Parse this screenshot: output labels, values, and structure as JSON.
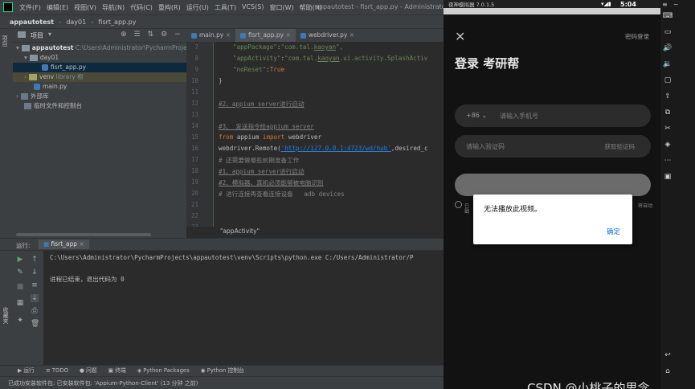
{
  "ide": {
    "window_title": "appautotest - fisrt_app.py - Administrator",
    "menus": [
      "文件(F)",
      "编辑(E)",
      "视图(V)",
      "导航(N)",
      "代码(C)",
      "重构(R)",
      "运行(U)",
      "工具(T)",
      "VCS(S)",
      "窗口(W)",
      "帮助(H)"
    ],
    "breadcrumb": [
      "appautotest",
      "day01",
      "fisrt_app.py"
    ],
    "project_panel_label": "项目",
    "left_strip_label": "项目",
    "tree": [
      {
        "label": "appautotest",
        "extra": "C:\\Users\\Administrator\\PycharmProjec",
        "type": "folder"
      },
      {
        "label": "day01",
        "extra": "",
        "type": "folder"
      },
      {
        "label": "fisrt_app.py",
        "extra": "",
        "type": "py"
      },
      {
        "label": "venv",
        "extra": "library 根",
        "type": "folder"
      },
      {
        "label": "main.py",
        "extra": "",
        "type": "py"
      },
      {
        "label": "外部库",
        "extra": "",
        "type": "lib"
      },
      {
        "label": "临时文件和控制台",
        "extra": "",
        "type": "scratch"
      }
    ],
    "editor_tabs": [
      "main.py",
      "fisrt_app.py",
      "webdriver.py"
    ],
    "line_numbers": [
      "7",
      "8",
      "9",
      "10",
      "11",
      "12",
      "13",
      "14",
      "15",
      "16",
      "17",
      "18",
      "19",
      "20",
      "21",
      "22",
      "23"
    ],
    "code": {
      "l7a": "\"appPackage\"",
      "l7b": ":",
      "l7c": "\"com.tal.",
      "l7d": "kaoyan",
      "l7e": "\",",
      "l8a": "\"appActivity\"",
      "l8b": ":",
      "l8c": "\"com.tal.",
      "l8d": "kaoyan",
      "l8e": ".ui.activity.SplashActiv",
      "l9a": "\"noReset\"",
      "l9b": ":",
      "l9c": "True",
      "l10": "}",
      "l12": "#2、appium server进行启动",
      "l14": "#3、 发送指令给appium server",
      "l15a": "from",
      "l15b": " appium ",
      "l15c": "import",
      "l15d": " webdriver",
      "l16a": "webdriver.Remote(",
      "l16b": "'http://127.0.0.1:4723/wd/hub'",
      "l16c": ",desired_c",
      "l17": "# 还需要做哪些前期准备工作",
      "l18": "#1、appium server进行启动",
      "l19": "#2、模拟器、真机必须能够被电脑识别",
      "l20": "# 进行连接再查看连接设备   adb devices"
    },
    "code_breadcrumb": "\"appActivity\"",
    "run_label": "运行:",
    "run_tab": "fisrt_app",
    "run_strip_label": "收藏夹",
    "console_lines": [
      "C:\\Users\\Administrator\\PycharmProjects\\appautotest\\venv\\Scripts\\python.exe C:/Users/Administrator/P",
      "",
      "进程已结束，退出代码为 0"
    ],
    "toolwindows": [
      "▶ 运行",
      "≡ TODO",
      "● 问题",
      "▣ 终端",
      "◈ Python Packages",
      "◉ Python 控制台"
    ],
    "status": "已成功安装软件包: 已安装软件包: 'Appium-Python-Client' (13 分钟 之前)"
  },
  "emulator": {
    "title": "夜神模拟器 7.0.1.5",
    "clock": "5:04",
    "password_login": "密码登录",
    "page_title": "登录 考研帮",
    "country_code": "+86",
    "phone_placeholder": "请输入手机号",
    "code_placeholder": "请输入验证码",
    "get_code": "获取验证码",
    "agree_left": "已",
    "agree_left2": "戳",
    "agree_right": "将自动",
    "dialog": {
      "message": "无法播放此视频。",
      "ok": "确定"
    }
  },
  "watermark": "CSDN @小桃子的思念"
}
